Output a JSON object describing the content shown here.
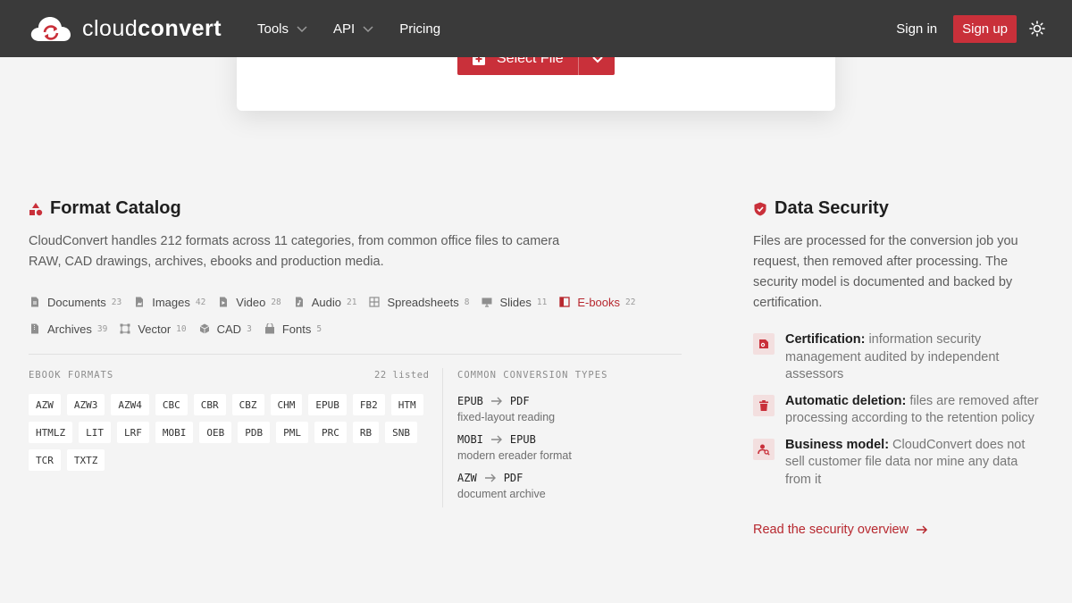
{
  "header": {
    "brand_light": "cloud",
    "brand_bold": "convert",
    "nav": [
      {
        "label": "Tools"
      },
      {
        "label": "API"
      },
      {
        "label": "Pricing"
      }
    ],
    "signin": "Sign in",
    "signup": "Sign up"
  },
  "upload": {
    "select_label": "Select File"
  },
  "catalog": {
    "title": "Format Catalog",
    "lead": "CloudConvert handles 212 formats across 11 categories, from common office files to camera RAW, CAD drawings, archives, ebooks and production media.",
    "categories": [
      {
        "label": "Documents",
        "count": "23",
        "icon": "document-icon"
      },
      {
        "label": "Images",
        "count": "42",
        "icon": "image-icon"
      },
      {
        "label": "Video",
        "count": "28",
        "icon": "video-icon"
      },
      {
        "label": "Audio",
        "count": "21",
        "icon": "audio-icon"
      },
      {
        "label": "Spreadsheets",
        "count": "8",
        "icon": "grid-icon"
      },
      {
        "label": "Slides",
        "count": "11",
        "icon": "presentation-icon"
      },
      {
        "label": "E-books",
        "count": "22",
        "icon": "book-icon"
      },
      {
        "label": "Archives",
        "count": "39",
        "icon": "archive-icon"
      },
      {
        "label": "Vector",
        "count": "10",
        "icon": "vector-icon"
      },
      {
        "label": "CAD",
        "count": "3",
        "icon": "cube-icon"
      },
      {
        "label": "Fonts",
        "count": "5",
        "icon": "font-icon"
      }
    ],
    "active_category": "E-books",
    "formats_label": "EBOOK FORMATS",
    "formats_count": "22 listed",
    "formats": [
      "AZW",
      "AZW3",
      "AZW4",
      "CBC",
      "CBR",
      "CBZ",
      "CHM",
      "EPUB",
      "FB2",
      "HTM",
      "HTMLZ",
      "LIT",
      "LRF",
      "MOBI",
      "OEB",
      "PDB",
      "PML",
      "PRC",
      "RB",
      "SNB",
      "TCR",
      "TXTZ"
    ],
    "conversions_label": "COMMON CONVERSION TYPES",
    "conversions": [
      {
        "from": "EPUB",
        "to": "PDF",
        "desc": "fixed-layout reading"
      },
      {
        "from": "MOBI",
        "to": "EPUB",
        "desc": "modern ereader format"
      },
      {
        "from": "AZW",
        "to": "PDF",
        "desc": "document archive"
      }
    ]
  },
  "security": {
    "title": "Data Security",
    "lead": "Files are processed for the conversion job you request, then removed after processing. The security model is documented and backed by certification.",
    "items": [
      {
        "title": "Certification:",
        "text": " information security management audited by independent assessors",
        "icon": "certificate-icon"
      },
      {
        "title": "Automatic deletion:",
        "text": " files are removed after processing according to the retention policy",
        "icon": "trash-icon"
      },
      {
        "title": "Business model:",
        "text": " CloudConvert does not sell customer file data nor mine any data from it",
        "icon": "user-search-icon"
      }
    ],
    "link": "Read the security overview"
  },
  "colors": {
    "brand_red": "#c9303a",
    "header_bg": "#3a3a3a",
    "page_bg": "#f4f4f4"
  }
}
